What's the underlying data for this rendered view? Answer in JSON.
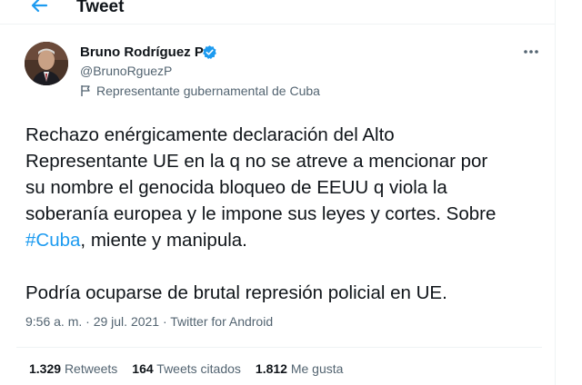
{
  "header": {
    "title": "Tweet"
  },
  "author": {
    "name": "Bruno Rodríguez P",
    "handle": "@BrunoRguezP",
    "label": "Representante gubernamental de Cuba"
  },
  "tweet": {
    "line1": "Rechazo enérgicamente declaración del Alto",
    "line2": "Representante UE en la q no se atreve a mencionar por",
    "line3": "su nombre el genocida bloqueo de EEUU q viola la",
    "line4": "soberanía europea y le impone sus leyes y cortes. Sobre",
    "hashtag": "#Cuba",
    "line5_rest": ", miente y manipula.",
    "line6": "Podría ocuparse de brutal represión policial en UE."
  },
  "meta": {
    "text": "9:56 a. m. · 29 jul. 2021 · Twitter for Android"
  },
  "stats": {
    "retweets_count": "1.329",
    "retweets_label": "Retweets",
    "quotes_count": "164",
    "quotes_label": "Tweets citados",
    "likes_count": "1.812",
    "likes_label": "Me gusta"
  },
  "colors": {
    "accent": "#1d9bf0",
    "text": "#0f1419",
    "secondary": "#536471"
  },
  "icons": {
    "back": "arrow-left-icon",
    "verified": "verified-badge-icon",
    "label": "flag-icon",
    "more": "more-horizontal-icon"
  }
}
